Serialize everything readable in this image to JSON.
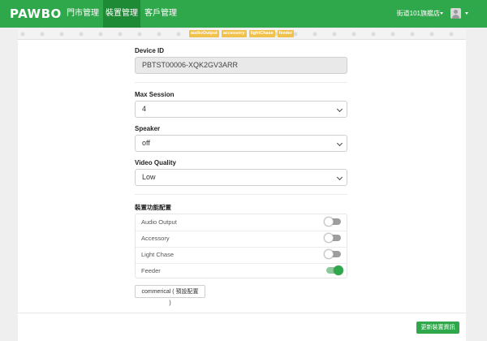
{
  "header": {
    "logo": "PAWBO",
    "nav": [
      {
        "label": "門市管理",
        "active": false
      },
      {
        "label": "裝置管理",
        "active": true
      },
      {
        "label": "客戶管理",
        "active": false
      }
    ],
    "store_name": "街道101旗艦店",
    "colors": {
      "brand": "#2ea84a",
      "active_tab": "#1f8a35"
    }
  },
  "banner": {
    "tags": [
      "audioOutput",
      "accessory",
      "lightChase",
      "feeder"
    ],
    "tag_color": "#f0c14b"
  },
  "form": {
    "device_id": {
      "label": "Device ID",
      "value": "PBTST00006-XQK2GV3ARR"
    },
    "max_session": {
      "label": "Max Session",
      "value": "4"
    },
    "speaker": {
      "label": "Speaker",
      "value": "off"
    },
    "video_quality": {
      "label": "Video Quality",
      "value": "Low"
    }
  },
  "features": {
    "title": "裝置功能配置",
    "items": [
      {
        "label": "Audio Output",
        "enabled": false
      },
      {
        "label": "Accessory",
        "enabled": false
      },
      {
        "label": "Light Chase",
        "enabled": false
      },
      {
        "label": "Feeder",
        "enabled": true
      }
    ]
  },
  "preset_button": "commerical ( 預設配置 )",
  "save_button": "更新裝置資訊"
}
